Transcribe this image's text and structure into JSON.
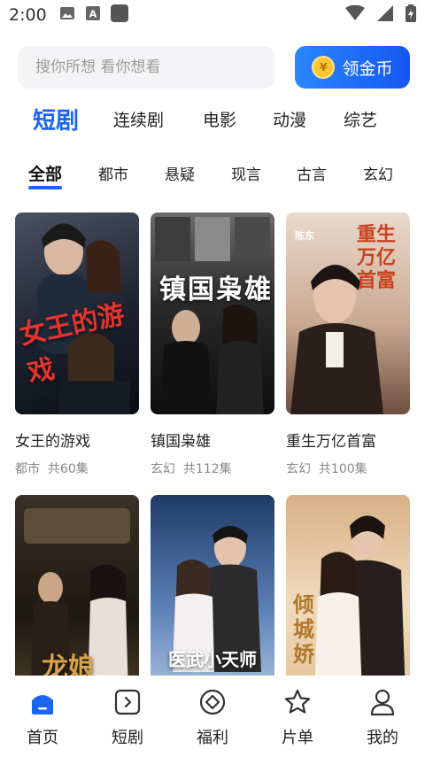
{
  "status_bar": {
    "time": "2:00",
    "icons": [
      "image-icon",
      "a-box-icon",
      "square-icon",
      "wifi-icon",
      "signal-icon",
      "battery-charging-icon"
    ]
  },
  "search": {
    "placeholder": "搜你所想 看你想看",
    "coin_button_label": "领金币",
    "coin_symbol": "¥"
  },
  "category_tabs": [
    {
      "label": "短剧",
      "active": true
    },
    {
      "label": "连续剧",
      "active": false
    },
    {
      "label": "电影",
      "active": false
    },
    {
      "label": "动漫",
      "active": false
    },
    {
      "label": "综艺",
      "active": false
    }
  ],
  "genre_tabs": [
    {
      "label": "全部",
      "active": true
    },
    {
      "label": "都市",
      "active": false
    },
    {
      "label": "悬疑",
      "active": false
    },
    {
      "label": "现言",
      "active": false
    },
    {
      "label": "古言",
      "active": false
    },
    {
      "label": "玄幻",
      "active": false
    }
  ],
  "dramas": [
    {
      "title": "女王的游戏",
      "genre": "都市",
      "episodes": "共60集",
      "poster_text": "女王的游戏",
      "colors": [
        "#3a3f4a",
        "#0e1420"
      ]
    },
    {
      "title": "镇国枭雄",
      "genre": "玄幻",
      "episodes": "共112集",
      "poster_text": "镇国枭雄",
      "colors": [
        "#595959",
        "#101010"
      ]
    },
    {
      "title": "重生万亿首富",
      "genre": "玄幻",
      "episodes": "共100集",
      "poster_text": "重生万亿首富",
      "poster_top": "陈东",
      "colors": [
        "#e7d3c4",
        "#8a6d5c"
      ]
    },
    {
      "title": "",
      "genre": "",
      "episodes": "",
      "poster_text": "龙娘",
      "colors": [
        "#2a241c",
        "#6b5a3f"
      ]
    },
    {
      "title": "",
      "genre": "",
      "episodes": "",
      "poster_text": "医武小天师",
      "colors": [
        "#2c4b7a",
        "#9fb6d8"
      ]
    },
    {
      "title": "",
      "genre": "",
      "episodes": "",
      "poster_text": "倾城娇",
      "colors": [
        "#d9b07a",
        "#f2dec0"
      ]
    }
  ],
  "bottom_nav": [
    {
      "label": "首页",
      "icon": "home-icon",
      "active": true
    },
    {
      "label": "短剧",
      "icon": "play-square-icon",
      "active": false
    },
    {
      "label": "福利",
      "icon": "welfare-icon",
      "active": false
    },
    {
      "label": "片单",
      "icon": "star-icon",
      "active": false
    },
    {
      "label": "我的",
      "icon": "user-icon",
      "active": false
    }
  ],
  "accent_color": "#1a66f0"
}
